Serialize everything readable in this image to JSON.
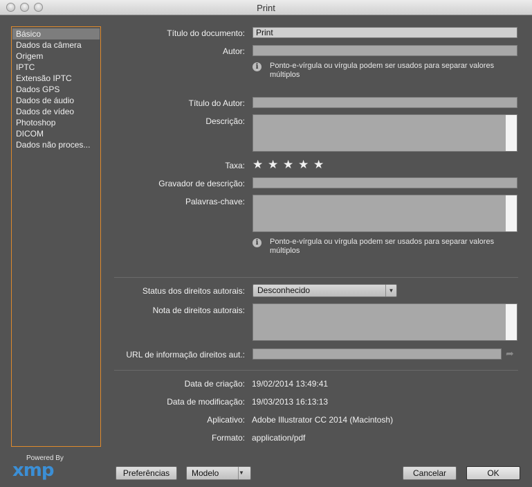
{
  "window": {
    "title": "Print"
  },
  "sidebar": {
    "items": [
      {
        "label": "Básico",
        "selected": true
      },
      {
        "label": "Dados da câmera"
      },
      {
        "label": "Origem"
      },
      {
        "label": "IPTC"
      },
      {
        "label": "Extensão IPTC"
      },
      {
        "label": "Dados GPS"
      },
      {
        "label": "Dados de áudio"
      },
      {
        "label": "Dados de vídeo"
      },
      {
        "label": "Photoshop"
      },
      {
        "label": "DICOM"
      },
      {
        "label": "Dados não proces..."
      }
    ]
  },
  "branding": {
    "powered": "Powered By",
    "logo": "xmp"
  },
  "form": {
    "doc_title_label": "Título do documento:",
    "doc_title_value": "Print",
    "author_label": "Autor:",
    "author_value": "",
    "hint_text": "Ponto-e-vírgula ou vírgula podem ser usados para separar valores múltiplos",
    "author_title_label": "Título do Autor:",
    "description_label": "Descrição:",
    "rating_label": "Taxa:",
    "rating_value": 0,
    "rating_max": 5,
    "description_writer_label": "Gravador de descrição:",
    "keywords_label": "Palavras-chave:",
    "keywords_hint": "Ponto-e-vírgula ou vírgula podem ser usados para separar valores múltiplos",
    "copyright_status_label": "Status dos direitos autorais:",
    "copyright_status_value": "Desconhecido",
    "copyright_notice_label": "Nota de direitos autorais:",
    "copyright_url_label": "URL de informação direitos aut.:",
    "created_label": "Data de criação:",
    "created_value": "19/02/2014 13:49:41",
    "modified_label": "Data de modificação:",
    "modified_value": "19/03/2013 16:13:13",
    "application_label": "Aplicativo:",
    "application_value": "Adobe Illustrator CC 2014 (Macintosh)",
    "format_label": "Formato:",
    "format_value": "application/pdf"
  },
  "footer": {
    "preferences": "Preferências",
    "template": "Modelo",
    "cancel": "Cancelar",
    "ok": "OK"
  },
  "colors": {
    "accent_border": "#e08a2c",
    "xmp_blue": "#3b8fd6",
    "panel_bg": "#535353"
  }
}
